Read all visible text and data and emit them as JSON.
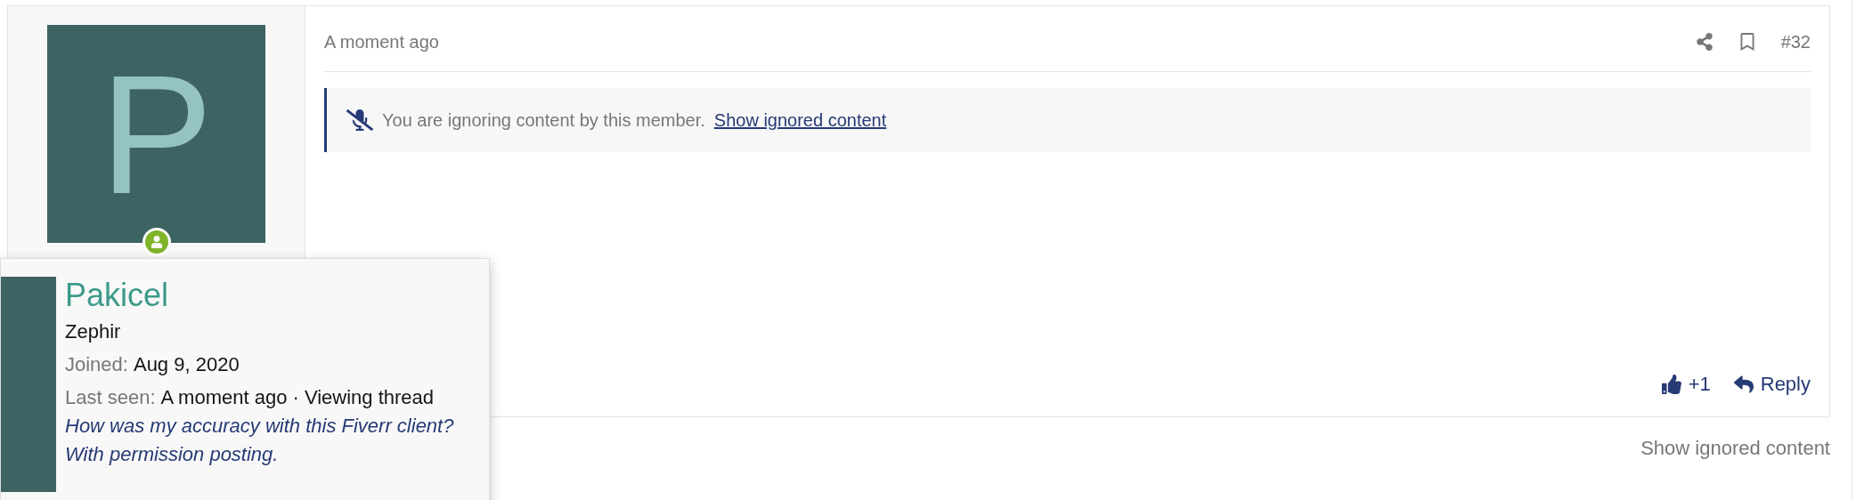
{
  "post": {
    "avatar_letter": "P",
    "online": true,
    "time": "A moment ago",
    "number": "#32",
    "ignored_notice": {
      "text": "You are ignoring content by this member.",
      "link": "Show ignored content"
    },
    "actions": [
      {
        "kind": "like",
        "label": "+1"
      },
      {
        "kind": "reply",
        "label": "Reply"
      }
    ]
  },
  "show_ignored": "Show ignored content",
  "member_tooltip": {
    "name": "Pakicel",
    "title": "Zephir",
    "stats": [
      {
        "label": "Joined:",
        "value": "Aug 9, 2020"
      },
      {
        "label": "Last seen:",
        "value": "A moment ago · Viewing thread"
      }
    ],
    "signature": "How was my accuracy with this Fiverr client? With permission posting."
  }
}
